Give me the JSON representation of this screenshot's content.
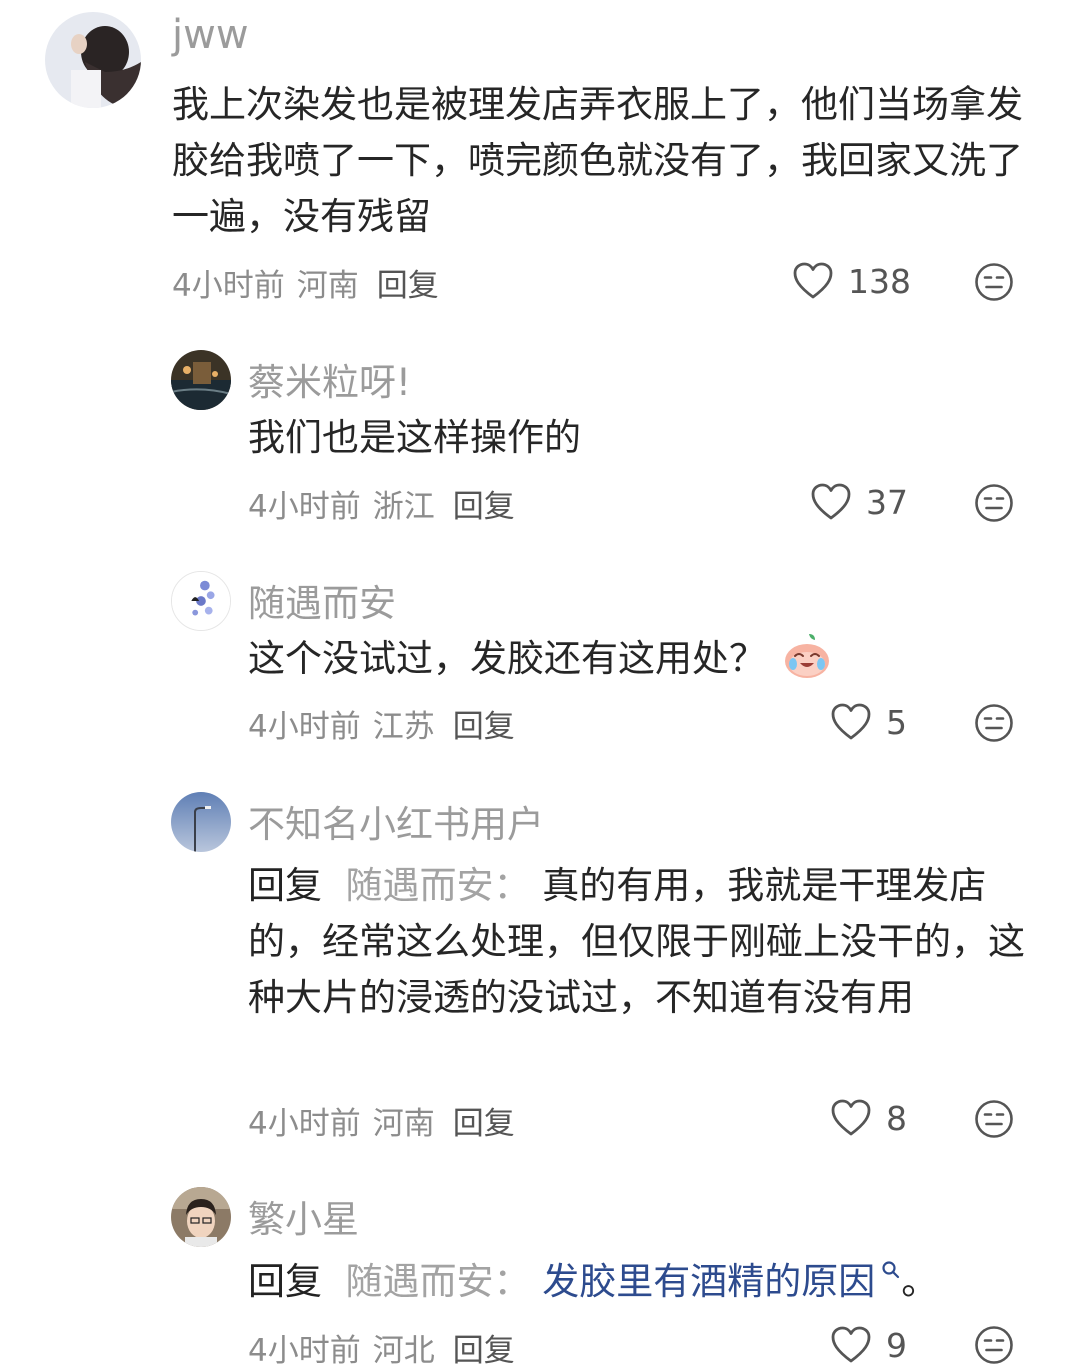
{
  "comments": [
    {
      "username": "jww",
      "text": "我上次染发也是被理发店弄衣服上了，他们当场拿发胶给我喷了一下，喷完颜色就没有了，我回家又洗了一遍，没有残留",
      "time": "4小时前",
      "location": "河南",
      "reply_label": "回复",
      "likes": "138"
    },
    {
      "username": "蔡米粒呀!",
      "text": "我们也是这样操作的",
      "time": "4小时前",
      "location": "浙江",
      "reply_label": "回复",
      "likes": "37"
    },
    {
      "username": "随遇而安",
      "text": "这个没试过，发胶还有这用处？",
      "time": "4小时前",
      "location": "江苏",
      "reply_label": "回复",
      "likes": "5"
    },
    {
      "username": "不知名小红书用户",
      "prefix": "回复",
      "mention": "随遇而安：",
      "text": "真的有用，我就是干理发店的，经常这么处理，但仅限于刚碰上没干的，这种大片的浸透的没试过，不知道有没有用",
      "time": "4小时前",
      "location": "河南",
      "reply_label": "回复",
      "likes": "8"
    },
    {
      "username": "繁小星",
      "prefix": "回复",
      "mention": "随遇而安：",
      "link_text": "发胶里有酒精的原因",
      "after_link": "。",
      "time": "4小时前",
      "location": "河北",
      "reply_label": "回复",
      "likes": "9"
    }
  ],
  "icons": {
    "like": "heart-outline-icon",
    "dislike": "neutral-face-icon",
    "search": "search-icon",
    "emoji": "crying-laughing-peach-emoji"
  },
  "colors": {
    "link": "#2d4b8e",
    "mention": "#a3a3a3",
    "meta": "#8c8c8c"
  }
}
